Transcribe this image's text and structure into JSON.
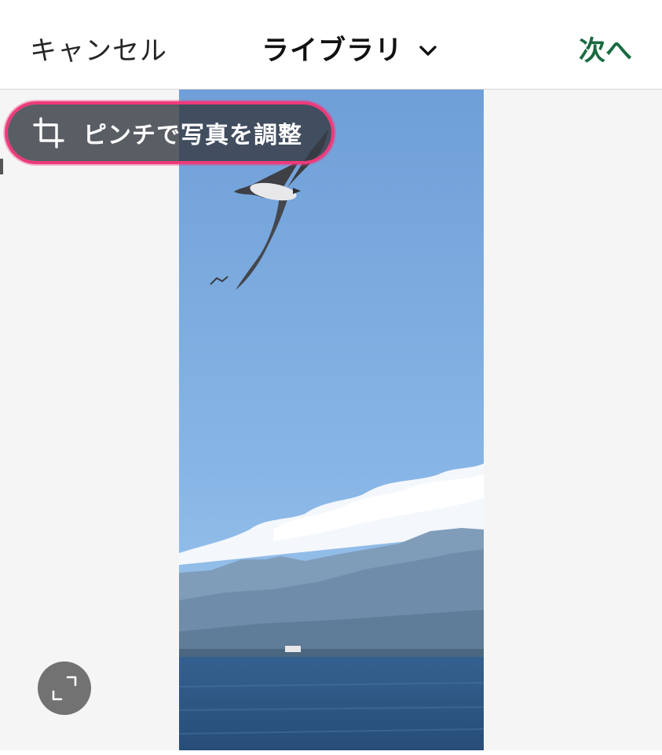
{
  "header": {
    "cancel_label": "キャンセル",
    "title": "ライブラリ",
    "next_label": "次へ"
  },
  "hint": {
    "text": "ピンチで写真を調整",
    "icon": "crop-icon"
  },
  "controls": {
    "expand_icon": "expand-icon",
    "dropdown_icon": "chevron-down-icon"
  },
  "colors": {
    "next_accent": "#1a6b40",
    "highlight": "#ee3a7a",
    "sky": "#7aa8de",
    "sea": "#2f5a8a"
  }
}
